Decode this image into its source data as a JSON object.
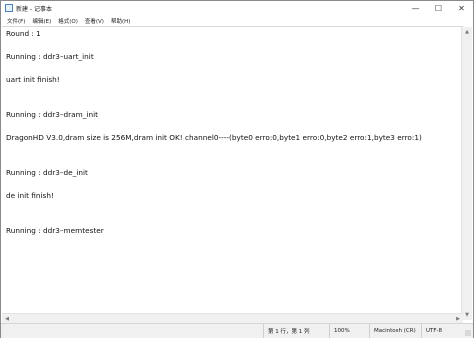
{
  "window": {
    "title": "新建 - 记事本",
    "controls": {
      "minimize": "—",
      "maximize": "☐",
      "close": "✕"
    }
  },
  "menubar": {
    "items": [
      "文件(F)",
      "编辑(E)",
      "格式(O)",
      "查看(V)",
      "帮助(H)"
    ]
  },
  "editor": {
    "content": "Round : 1\n\nRunning : ddr3–uart_init\n\nuart init finish!\n\n\nRunning : ddr3–dram_init\n\nDragonHD V3.0,dram size is 256M,dram init OK! channel0----(byte0 erro:0,byte1 erro:0,byte2 erro:1,byte3 erro:1)\n\n\nRunning : ddr3–de_init\n\nde init finish!\n\n\nRunning : ddr3–memtester"
  },
  "statusbar": {
    "position": "第 1 行，第 1 列",
    "zoom": "100%",
    "line_ending": "Macintosh (CR)",
    "encoding": "UTF-8"
  },
  "icons": {
    "app": "notepad-icon",
    "scroll_up": "scroll-up-arrow-icon",
    "scroll_down": "scroll-down-arrow-icon",
    "scroll_left": "scroll-left-arrow-icon",
    "scroll_right": "scroll-right-arrow-icon",
    "resize": "resize-grip-icon"
  }
}
